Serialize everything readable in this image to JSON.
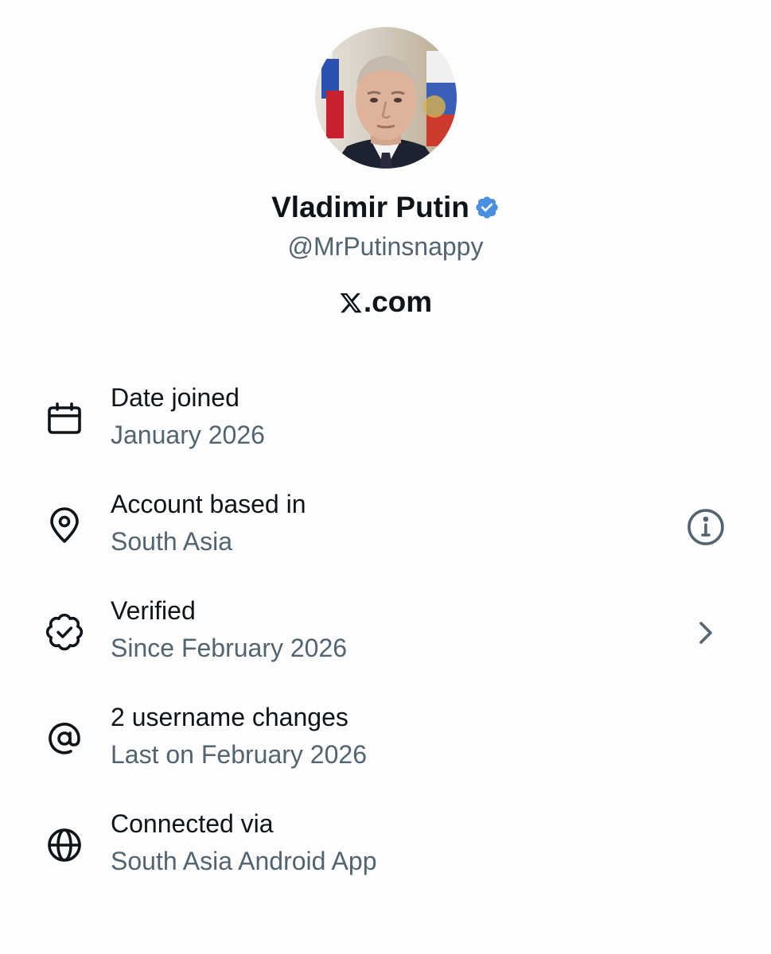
{
  "profile": {
    "name": "Vladimir Putin",
    "handle": "@MrPutinsnappy",
    "brand_suffix": ".com",
    "avatar_icon": "profile-photo",
    "verified_icon": "verified-badge-icon",
    "verified_color": "#4a90e2"
  },
  "about": {
    "rows": [
      {
        "title": "Date joined",
        "value": "January 2026",
        "icon": "calendar-icon"
      },
      {
        "title": "Account based in",
        "value": "South Asia",
        "icon": "location-pin-icon",
        "action_icon": "info-icon"
      },
      {
        "title": "Verified",
        "value": "Since February 2026",
        "icon": "verified-badge-outline-icon",
        "action_icon": "chevron-right-icon"
      },
      {
        "title": "2 username changes",
        "value": "Last on February 2026",
        "icon": "at-sign-icon"
      },
      {
        "title": "Connected via",
        "value": "South Asia Android App",
        "icon": "globe-icon"
      }
    ]
  },
  "colors": {
    "text_primary": "#0f1419",
    "text_secondary": "#536471",
    "background": "#fdfdfd"
  }
}
